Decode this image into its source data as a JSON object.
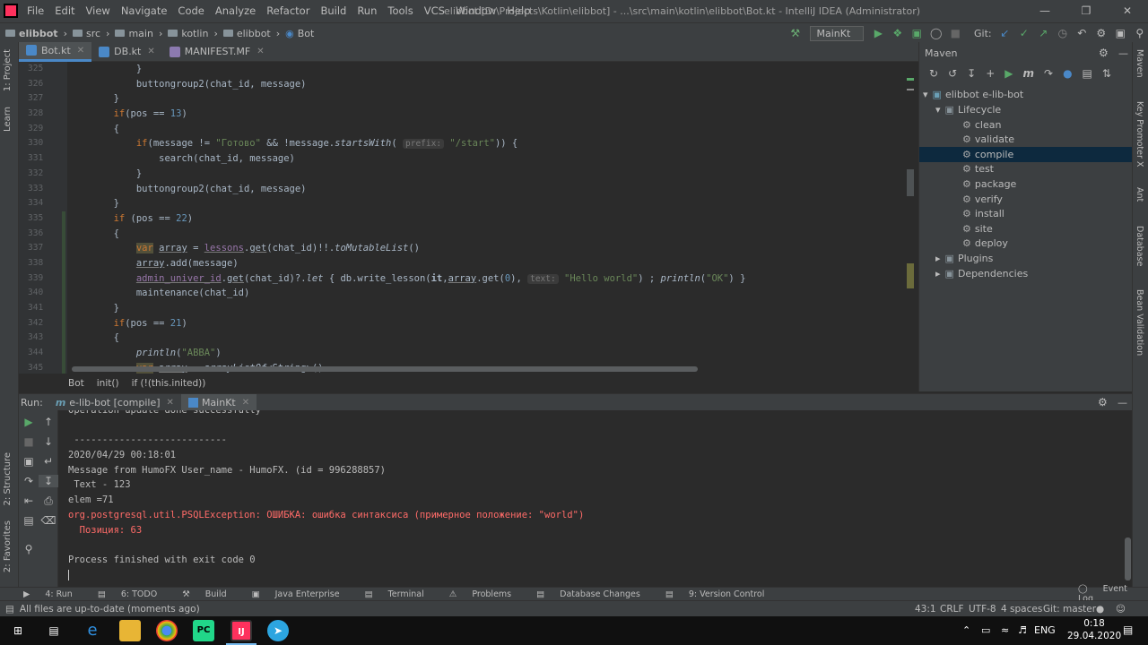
{
  "menu": [
    "File",
    "Edit",
    "View",
    "Navigate",
    "Code",
    "Analyze",
    "Refactor",
    "Build",
    "Run",
    "Tools",
    "VCS",
    "Window",
    "Help"
  ],
  "window_title": "elibbot [D:\\Projects\\Kotlin\\elibbot] - ...\\src\\main\\kotlin\\elibbot\\Bot.kt - IntelliJ IDEA (Administrator)",
  "nav": {
    "crumbs": [
      "elibbot",
      "src",
      "main",
      "kotlin",
      "elibbot",
      "Bot"
    ],
    "run_config": "MainKt",
    "git_label": "Git:"
  },
  "left_strip": [
    "1: Project",
    "Learn",
    "2: Structure",
    "2: Favorites"
  ],
  "editor_tabs": [
    {
      "label": "Bot.kt",
      "active": true
    },
    {
      "label": "DB.kt",
      "active": false
    },
    {
      "label": "MANIFEST.MF",
      "active": false
    }
  ],
  "line_numbers": [
    "325",
    "326",
    "327",
    "328",
    "329",
    "330",
    "331",
    "332",
    "333",
    "334",
    "335",
    "336",
    "337",
    "338",
    "339",
    "340",
    "341",
    "342",
    "343",
    "344",
    "345"
  ],
  "code": {
    "l325": "            }",
    "l326": "            buttongroup2(chat_id, message)",
    "l327": "        }",
    "l328a": "        if",
    "l328b": "(pos == ",
    "l328c": "13",
    "l328d": ")",
    "l329": "        {",
    "l330a": "            if",
    "l330b": "(message != ",
    "l330c": "\"Готово\"",
    "l330d": " && !message.",
    "l330e": "startsWith",
    "l330f": "( ",
    "l330g": "prefix:",
    "l330h": " \"/start\"",
    "l330i": ")) {",
    "l331": "                search(chat_id, message)",
    "l332": "            }",
    "l333": "            buttongroup2(chat_id, message)",
    "l334": "        }",
    "l335a": "        if",
    "l335b": " (pos == ",
    "l335c": "22",
    "l335d": ")",
    "l336": "        {",
    "l337a": "            ",
    "l337b": "var",
    "l337c": " ",
    "l337d": "array",
    "l337e": " = ",
    "l337f": "lessons",
    "l337g": ".",
    "l337h": "get",
    "l337i": "(chat_id)!!.",
    "l337j": "toMutableList",
    "l337k": "()",
    "l338a": "            ",
    "l338b": "array",
    "l338c": ".add(message)",
    "l339a": "            ",
    "l339b": "admin_univer_id",
    "l339c": ".",
    "l339d": "get",
    "l339e": "(chat_id)?.",
    "l339f": "let",
    "l339g": " { db.write_lesson(",
    "l339h": "it",
    "l339i": ",",
    "l339j": "array",
    "l339k": ".get(",
    "l339l": "0",
    "l339m": "), ",
    "l339n": "text:",
    "l339o": " \"Hello world\"",
    "l339p": ") ; ",
    "l339q": "println",
    "l339r": "(",
    "l339s": "\"OK\"",
    "l339t": ") }",
    "l340": "            maintenance(chat_id)",
    "l341": "        }",
    "l342a": "        if",
    "l342b": "(pos == ",
    "l342c": "21",
    "l342d": ")",
    "l343": "        {",
    "l344a": "            ",
    "l344b": "println",
    "l344c": "(",
    "l344d": "\"ABBA\"",
    "l344e": ")",
    "l345a": "            ",
    "l345b": "var",
    "l345c": " ",
    "l345d": "array",
    "l345e": " = ",
    "l345f": "arrayListOf",
    "l345g": "<String>()"
  },
  "editor_breadcrumb": [
    "Bot",
    "init()",
    "if (!(this.inited))"
  ],
  "maven": {
    "title": "Maven",
    "root": "elibbot e-lib-bot",
    "lifecycle": "Lifecycle",
    "goals": [
      "clean",
      "validate",
      "compile",
      "test",
      "package",
      "verify",
      "install",
      "site",
      "deploy"
    ],
    "selected": "compile",
    "plugins": "Plugins",
    "dependencies": "Dependencies"
  },
  "right_strip": [
    "Maven",
    "Key Promoter X",
    "Ant",
    "Database",
    "Bean Validation"
  ],
  "run": {
    "label": "Run:",
    "tabs": [
      {
        "label": "e-lib-bot [compile]",
        "active": false
      },
      {
        "label": "MainKt",
        "active": true
      }
    ]
  },
  "console": [
    {
      "text": "Operation update done successfully",
      "err": false
    },
    {
      "text": "",
      "err": false
    },
    {
      "text": " ---------------------------",
      "err": false
    },
    {
      "text": "2020/04/29 00:18:01",
      "err": false
    },
    {
      "text": "Message from HumoFX User_name - HumoFX. (id = 996288857)",
      "err": false
    },
    {
      "text": " Text - 123",
      "err": false
    },
    {
      "text": "elem =71",
      "err": false
    },
    {
      "text": "org.postgresql.util.PSQLException: ОШИБКА: ошибка синтаксиса (примерное положение: \"world\")",
      "err": true
    },
    {
      "text": "  Позиция: 63",
      "err": true
    },
    {
      "text": "",
      "err": false
    },
    {
      "text": "Process finished with exit code 0",
      "err": false
    }
  ],
  "tool_tabs": [
    "4: Run",
    "6: TODO",
    "Build",
    "Java Enterprise",
    "Terminal",
    "Problems",
    "Database Changes",
    "9: Version Control"
  ],
  "event_log": "Event Log",
  "status": {
    "message": "All files are up-to-date (moments ago)",
    "position": "43:1",
    "line_sep": "CRLF",
    "encoding": "UTF-8",
    "indent": "4 spaces",
    "git_branch": "Git: master"
  },
  "taskbar": {
    "lang": "ENG",
    "time": "0:18",
    "date": "29.04.2020"
  },
  "colors": {
    "accent": "#4a88c7",
    "error": "#ff6b68",
    "keyword": "#cc7832",
    "string": "#6a8759",
    "number": "#6897bb"
  }
}
